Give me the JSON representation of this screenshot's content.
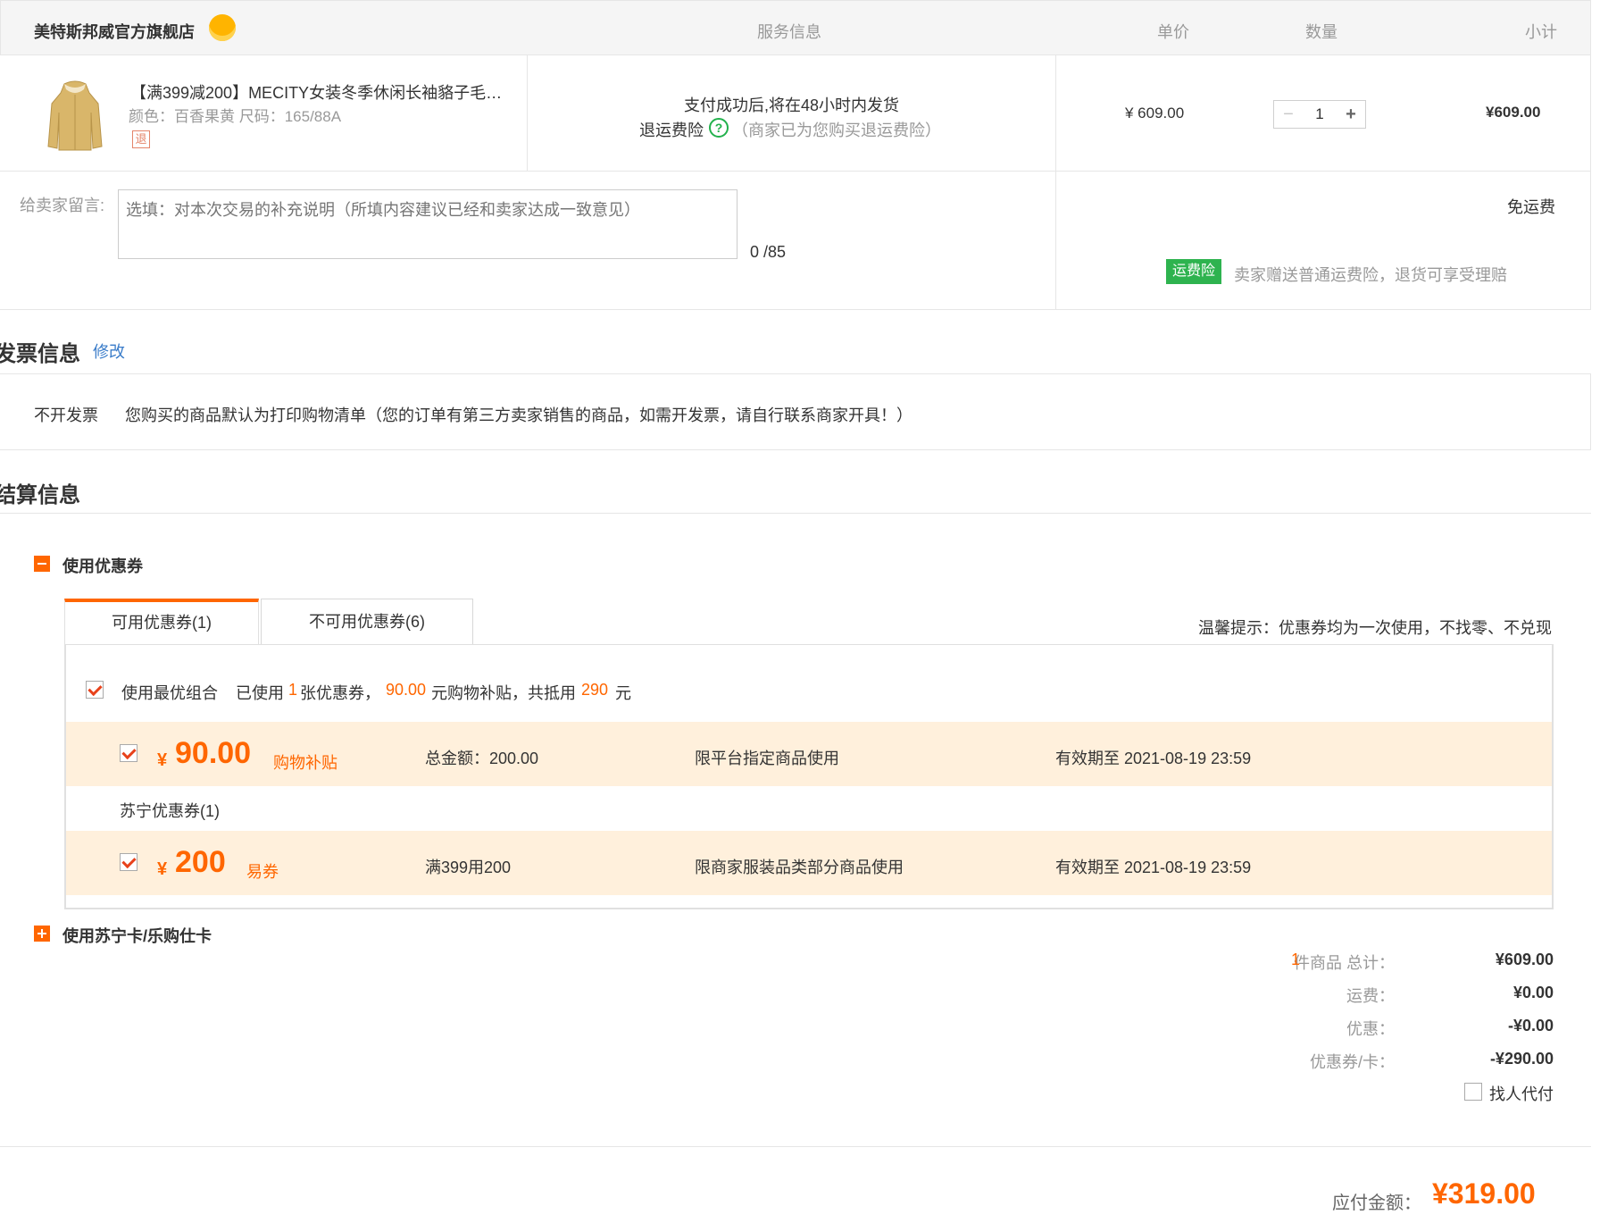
{
  "store": {
    "name": "美特斯邦威官方旗舰店",
    "badge_icon": "sun-badge-icon"
  },
  "columns": {
    "service": "服务信息",
    "unit_price": "单价",
    "quantity": "数量",
    "subtotal": "小计"
  },
  "product": {
    "name": "【满399减200】MECITY女装冬季休闲长袖貉子毛…",
    "spec": "颜色：百香果黄   尺码：165/88A",
    "return_badge": "退",
    "ship_note": "支付成功后,将在48小时内发货",
    "return_freight_label": "退运费险",
    "return_freight_help": "?",
    "return_freight_note": "（商家已为您购买退运费险）",
    "unit_price": "¥ 609.00",
    "quantity": "1",
    "qty_minus": "−",
    "qty_plus": "+",
    "subtotal": "¥609.00"
  },
  "message": {
    "label": "给卖家留言:",
    "placeholder": "选填：对本次交易的补充说明（所填内容建议已经和卖家达成一致意见）",
    "counter": "0 /85",
    "shipping": "免运费",
    "freight_tag": "运费险",
    "freight_tag_note": "卖家赠送普通运费险，退货可享受理赔"
  },
  "invoice": {
    "title": "发票信息",
    "edit": "修改",
    "type": "不开发票",
    "note": "您购买的商品默认为打印购物清单（您的订单有第三方卖家销售的商品，如需开发票，请自行联系商家开具！）"
  },
  "settlement": {
    "title": "结算信息",
    "coupon_section": "使用优惠券",
    "tabs": [
      {
        "label": "可用优惠券(1)",
        "active": true
      },
      {
        "label": "不可用优惠券(6)",
        "active": false
      }
    ],
    "tip": "温馨提示：优惠券均为一次使用，不找零、不兑现",
    "best_combo_label": "使用最优组合",
    "summary": {
      "p1": "已使用",
      "count": "1",
      "p2": "张优惠券，",
      "subsidy": "90.00",
      "p3": "元购物补贴，共抵用",
      "offset": "290",
      "p4": "元"
    },
    "coupons": [
      {
        "currency": "¥",
        "amount": "90.00",
        "type": "购物补贴",
        "total": "总金额：200.00",
        "scope": "限平台指定商品使用",
        "expiry": "有效期至 2021-08-19 23:59"
      },
      {
        "currency": "¥",
        "amount": "200",
        "type": "易券",
        "total": "满399用200",
        "scope": "限商家服装品类部分商品使用",
        "expiry": "有效期至 2021-08-19 23:59"
      }
    ],
    "suning_group": "苏宁优惠券(1)",
    "card_section": "使用苏宁卡/乐购仕卡"
  },
  "totals": {
    "count": "1",
    "items_label": "件商品 总计：",
    "items_value": "¥609.00",
    "shipping_label": "运费：",
    "shipping_value": "¥0.00",
    "discount_label": "优惠：",
    "discount_value": "-¥0.00",
    "coupon_label": "优惠券/卡：",
    "coupon_value": "-¥290.00",
    "pay_for_label": "找人代付",
    "payable_label": "应付金额：",
    "payable_value": "¥319.00"
  },
  "colors": {
    "accent": "#ff6600",
    "coupon_bg": "#fff0dc",
    "freight_green": "#2eb34f",
    "link_blue": "#3a7cc9"
  }
}
